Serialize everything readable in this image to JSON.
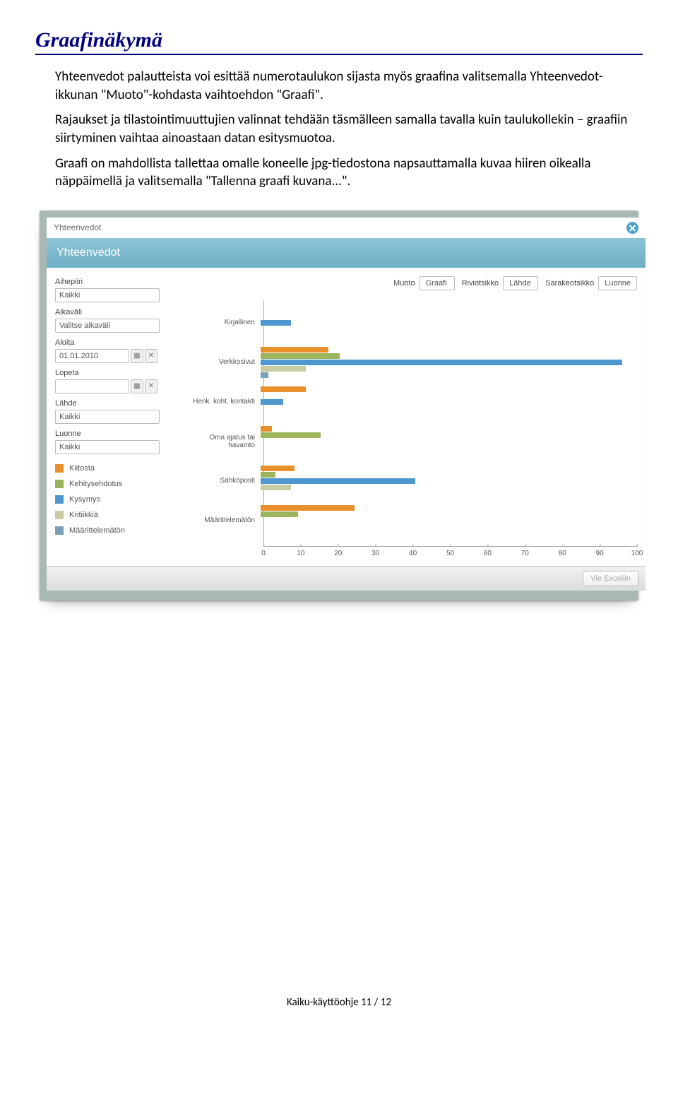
{
  "page_title": "Graafinäkymä",
  "paragraphs": [
    "Yhteenvedot palautteista voi esittää numerotaulukon sijasta myös graafina valitsemalla Yhteenvedot-ikkunan \"Muoto\"-kohdasta vaihtoehdon \"Graafi\".",
    "Rajaukset ja tilastointimuuttujien valinnat tehdään täsmälleen samalla tavalla kuin taulukollekin – graafiin siirtyminen vaihtaa ainoastaan datan esitysmuotoa.",
    "Graafi on mahdollista tallettaa omalle koneelle jpg-tiedostona napsauttamalla kuvaa hiiren oikealla näppäimellä ja valitsemalla \"Tallenna graafi kuvana...\"."
  ],
  "window": {
    "outer_title": "Yhteenvedot",
    "header": "Yhteenvedot"
  },
  "sidebar": {
    "aihepiiri": {
      "label": "Aihepiiri",
      "value": "Kaikki"
    },
    "aikavali": {
      "label": "Aikaväli",
      "value": "Valitse aikaväli"
    },
    "aloita": {
      "label": "Aloita",
      "value": "01.01.2010"
    },
    "lopeta": {
      "label": "Lopeta",
      "value": ""
    },
    "lahde": {
      "label": "Lähde",
      "value": "Kaikki"
    },
    "luonne": {
      "label": "Luonne",
      "value": "Kaikki"
    }
  },
  "legend": [
    {
      "label": "Kiitosta",
      "color": "#e98f2b"
    },
    {
      "label": "Kehitysehdotus",
      "color": "#9bb55d"
    },
    {
      "label": "Kysymys",
      "color": "#4f98cf"
    },
    {
      "label": "Kritiikkiä",
      "color": "#c9cba3"
    },
    {
      "label": "Määrittelemätön",
      "color": "#7a9fb8"
    }
  ],
  "top_controls": {
    "muoto": {
      "label": "Muoto",
      "value": "Graafi"
    },
    "riviotsikko": {
      "label": "Riviotsikko",
      "value": "Lähde"
    },
    "sarakeotsikko": {
      "label": "Sarakeotsikko",
      "value": "Luonne"
    }
  },
  "chart_data": {
    "type": "bar",
    "orientation": "horizontal",
    "xlabel": "",
    "ylabel": "",
    "xlim": [
      0,
      100
    ],
    "ticks": [
      0,
      10,
      20,
      30,
      40,
      50,
      60,
      70,
      80,
      90,
      100
    ],
    "categories": [
      "Kirjallinen",
      "Verkkosivut",
      "Henk. koht. kontakti",
      "Oma ajatus tai havainto",
      "Sähköposti",
      "Määrittelemätön"
    ],
    "series": [
      {
        "name": "Kiitosta",
        "color": "#e98f2b",
        "values": [
          0,
          18,
          12,
          3,
          9,
          25
        ]
      },
      {
        "name": "Kehitysehdotus",
        "color": "#9bb55d",
        "values": [
          0,
          21,
          0,
          16,
          4,
          10
        ]
      },
      {
        "name": "Kysymys",
        "color": "#4f98cf",
        "values": [
          8,
          96,
          6,
          0,
          41,
          0
        ]
      },
      {
        "name": "Kritiikkiä",
        "color": "#c9cba3",
        "values": [
          0,
          12,
          0,
          0,
          8,
          0
        ]
      },
      {
        "name": "Määrittelemätön",
        "color": "#7a9fb8",
        "values": [
          0,
          2,
          0,
          0,
          0,
          0
        ]
      }
    ]
  },
  "bottom_button": "Vie Exceliin",
  "footer": "Kaiku-käyttöohje 11 / 12"
}
